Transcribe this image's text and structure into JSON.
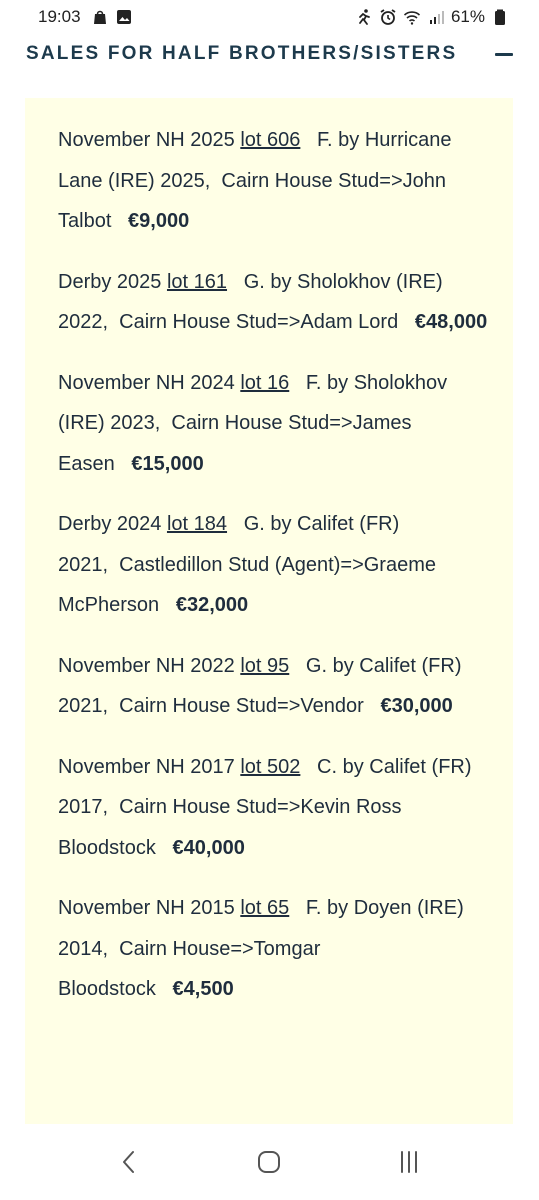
{
  "status_bar": {
    "time": "19:03",
    "battery_percent": "61%",
    "left_icons": [
      "shopping-bag-icon",
      "image-icon"
    ],
    "right_icons": [
      "running-person-icon",
      "alarm-icon",
      "wifi-icon",
      "signal-icon",
      "battery-icon"
    ]
  },
  "section": {
    "title": "SALES FOR HALF BROTHERS/SISTERS",
    "collapse_icon": "minus-icon"
  },
  "sales": [
    {
      "sale": "November NH 2025",
      "lot": "lot 606",
      "details": "F. by Hurricane Lane (IRE) 2025,  Cairn House Stud=>John Talbot",
      "price": "€9,000"
    },
    {
      "sale": "Derby 2025",
      "lot": "lot 161",
      "details": "G. by Sholokhov (IRE) 2022,  Cairn House Stud=>Adam Lord",
      "price": "€48,000"
    },
    {
      "sale": "November NH 2024",
      "lot": "lot 16",
      "details": "F. by Sholokhov (IRE) 2023,  Cairn House Stud=>James Easen",
      "price": "€15,000"
    },
    {
      "sale": "Derby 2024",
      "lot": "lot 184",
      "details": "G. by Califet (FR) 2021,  Castledillon Stud (Agent)=>Graeme McPherson",
      "price": "€32,000"
    },
    {
      "sale": "November NH 2022",
      "lot": "lot 95",
      "details": "G. by Califet (FR) 2021,  Cairn House Stud=>Vendor",
      "price": "€30,000"
    },
    {
      "sale": "November NH 2017",
      "lot": "lot 502",
      "details": "C. by Califet (FR) 2017,  Cairn House Stud=>Kevin Ross Bloodstock",
      "price": "€40,000"
    },
    {
      "sale": "November NH 2015",
      "lot": "lot 65",
      "details": "F. by Doyen (IRE) 2014,  Cairn House=>Tomgar Bloodstock",
      "price": "€4,500"
    }
  ],
  "nav_bar": {
    "buttons": [
      "back-icon",
      "home-icon",
      "recent-apps-icon"
    ]
  },
  "colors": {
    "panel_background": "#ffffe6",
    "title_color": "#1d3a4c",
    "text_color": "#1f2d3d"
  }
}
